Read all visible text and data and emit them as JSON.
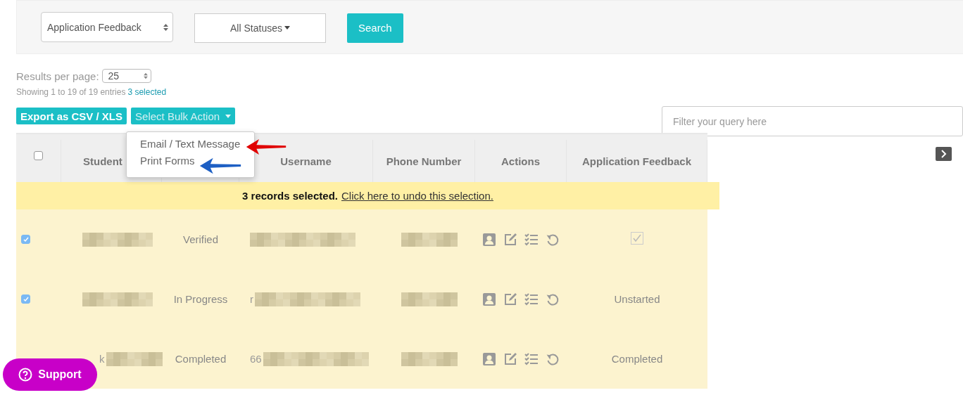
{
  "filters": {
    "form_select": "Application Feedback",
    "status_dropdown": "All Statuses",
    "search_button": "Search"
  },
  "results_per_page": {
    "label": "Results per page:",
    "value": "25"
  },
  "summary": {
    "text": "Showing 1 to 19 of 19 entries",
    "selected_link": "3 selected"
  },
  "toolbar": {
    "export_button": "Export as CSV / XLS",
    "bulk_action_button": "Select Bulk Action",
    "filter": {
      "placeholder": "Filter your query here"
    }
  },
  "bulk_menu": {
    "expanded": true,
    "items": [
      {
        "label": "Email / Text Message"
      },
      {
        "label": "Print Forms"
      }
    ]
  },
  "table": {
    "select_all_checked": false,
    "columns": [
      "Student",
      "Username",
      "Phone Number",
      "Actions",
      "Application Feedback"
    ],
    "selection_notice": {
      "text": "**3 records selected.**",
      "undo_link": "Click here to undo this selection."
    },
    "rows": [
      {
        "checked": true,
        "student": {
          "redacted": true
        },
        "status": "Verified",
        "username": {
          "redacted": true
        },
        "phone": {
          "redacted": true
        },
        "feedback": {
          "kind": "checkbox",
          "checked": true
        }
      },
      {
        "checked": true,
        "student": {
          "redacted": true
        },
        "status": "In Progress",
        "username": {
          "text": "r",
          "redacted": true
        },
        "phone": {
          "redacted": true
        },
        "feedback": {
          "kind": "text",
          "text": "Unstarted"
        }
      },
      {
        "student": {
          "text": "k",
          "redacted": true
        },
        "status": "Completed",
        "username": {
          "text": "66",
          "redacted": true
        },
        "phone": {
          "redacted": true
        },
        "feedback": {
          "kind": "text",
          "text": "Completed"
        }
      }
    ]
  },
  "support_button": "Support"
}
